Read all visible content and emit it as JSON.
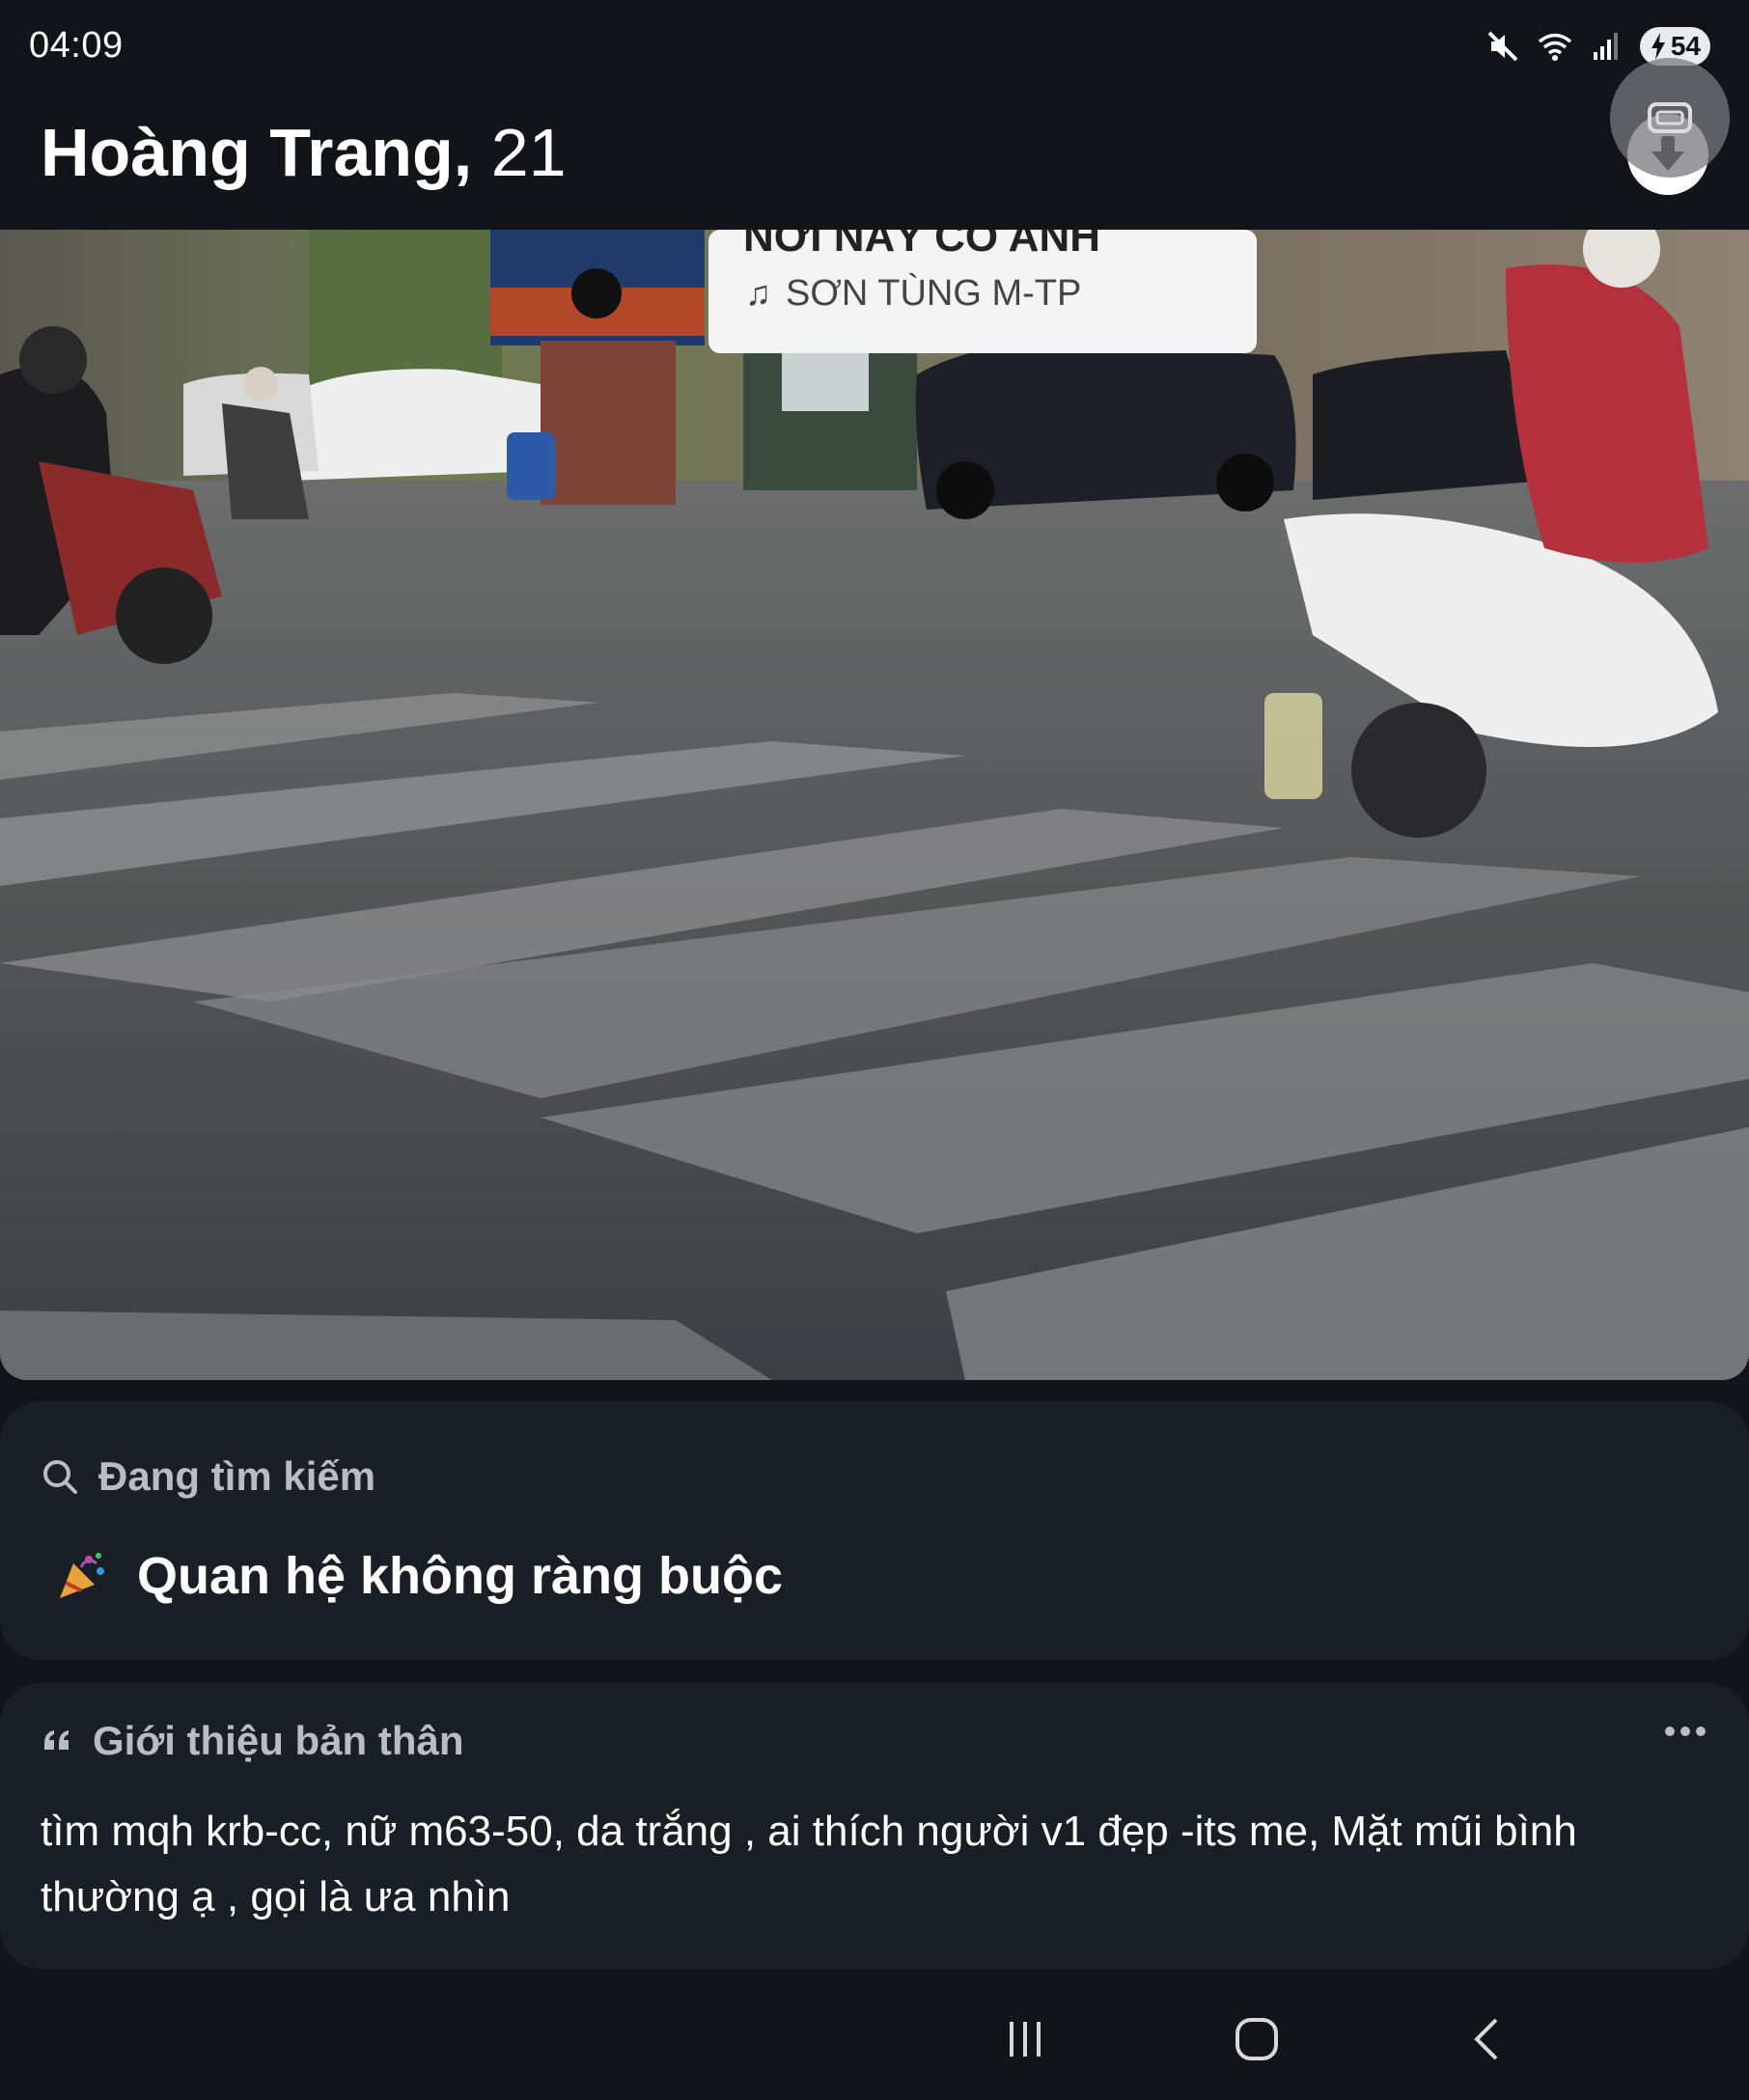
{
  "status_bar": {
    "time": "04:09",
    "battery": "54",
    "icons": [
      "mute-icon",
      "wifi-icon",
      "signal-icon",
      "battery-charging-icon"
    ]
  },
  "header": {
    "name": "Hoàng Trang,",
    "age": "21"
  },
  "photo": {
    "song_artist": "SƠN TÙNG M-TP"
  },
  "looking_for": {
    "title": "Đang tìm kiếm",
    "value": "Quan hệ không ràng buộc"
  },
  "about": {
    "title": "Giới thiệu bản thân",
    "text": "tìm mqh krb-cc, nữ m63-50, da trắng , ai thích người v1 đẹp -its me, Mặt mũi bình thường ạ , gọi là ưa nhìn"
  },
  "nav": {
    "buttons": [
      "recent-apps",
      "home",
      "back"
    ]
  }
}
